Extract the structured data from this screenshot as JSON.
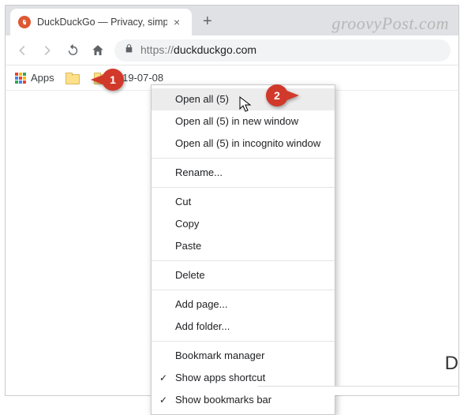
{
  "watermark": "groovyPost.com",
  "tab": {
    "title": "DuckDuckGo — Privacy, simplifie"
  },
  "toolbar": {
    "url_prefix": "https://",
    "url_host": "duckduckgo.com"
  },
  "bookmarks_bar": {
    "apps_label": "Apps",
    "folders": [
      {
        "label": ""
      },
      {
        "label": "2019-07-08"
      }
    ]
  },
  "callouts": {
    "one": "1",
    "two": "2"
  },
  "context_menu": {
    "open_all": "Open all (5)",
    "open_all_new_window": "Open all (5) in new window",
    "open_all_incognito": "Open all (5) in incognito window",
    "rename": "Rename...",
    "cut": "Cut",
    "copy": "Copy",
    "paste": "Paste",
    "delete": "Delete",
    "add_page": "Add page...",
    "add_folder": "Add folder...",
    "bookmark_manager": "Bookmark manager",
    "show_apps": "Show apps shortcut",
    "show_bookmarks": "Show bookmarks bar"
  },
  "page_letter": "D"
}
